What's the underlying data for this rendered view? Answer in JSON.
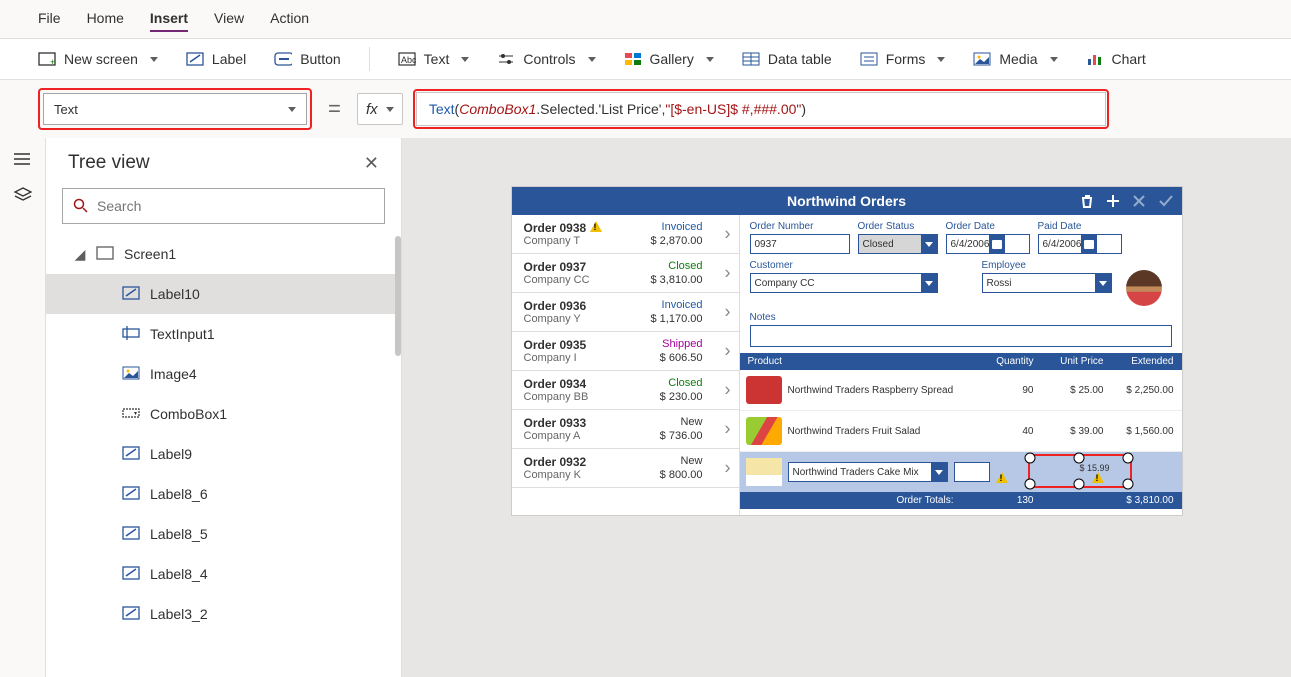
{
  "menu": {
    "file": "File",
    "home": "Home",
    "insert": "Insert",
    "view": "View",
    "action": "Action",
    "active": "insert"
  },
  "ribbon": {
    "newscreen": "New screen",
    "label": "Label",
    "button": "Button",
    "text": "Text",
    "controls": "Controls",
    "gallery": "Gallery",
    "datatable": "Data table",
    "forms": "Forms",
    "media": "Media",
    "chart": "Chart"
  },
  "property": {
    "name": "Text"
  },
  "formula": {
    "fn": "Text",
    "open": "( ",
    "obj": "ComboBox1",
    "mid": ".Selected.'List Price', ",
    "str": "\"[$-en-US]$ #,###.00\"",
    "close": " )"
  },
  "tree": {
    "title": "Tree view",
    "search_placeholder": "Search",
    "items": [
      {
        "name": "Screen1",
        "icon": "screen",
        "depth": 1,
        "expand": true
      },
      {
        "name": "Label10",
        "icon": "label",
        "depth": 2,
        "selected": true
      },
      {
        "name": "TextInput1",
        "icon": "textinput",
        "depth": 2
      },
      {
        "name": "Image4",
        "icon": "image",
        "depth": 2
      },
      {
        "name": "ComboBox1",
        "icon": "combobox",
        "depth": 2
      },
      {
        "name": "Label9",
        "icon": "label",
        "depth": 2
      },
      {
        "name": "Label8_6",
        "icon": "label",
        "depth": 2
      },
      {
        "name": "Label8_5",
        "icon": "label",
        "depth": 2
      },
      {
        "name": "Label8_4",
        "icon": "label",
        "depth": 2
      },
      {
        "name": "Label3_2",
        "icon": "label",
        "depth": 2
      }
    ]
  },
  "app": {
    "title": "Northwind Orders",
    "orders": [
      {
        "id": "Order 0938",
        "company": "Company T",
        "status": "Invoiced",
        "statusClass": "st-invoiced",
        "amount": "$ 2,870.00",
        "warn": true
      },
      {
        "id": "Order 0937",
        "company": "Company CC",
        "status": "Closed",
        "statusClass": "st-closed",
        "amount": "$ 3,810.00"
      },
      {
        "id": "Order 0936",
        "company": "Company Y",
        "status": "Invoiced",
        "statusClass": "st-invoiced",
        "amount": "$ 1,170.00"
      },
      {
        "id": "Order 0935",
        "company": "Company I",
        "status": "Shipped",
        "statusClass": "st-shipped",
        "amount": "$ 606.50"
      },
      {
        "id": "Order 0934",
        "company": "Company BB",
        "status": "Closed",
        "statusClass": "st-closed",
        "amount": "$ 230.00"
      },
      {
        "id": "Order 0933",
        "company": "Company A",
        "status": "New",
        "statusClass": "st-new",
        "amount": "$ 736.00"
      },
      {
        "id": "Order 0932",
        "company": "Company K",
        "status": "New",
        "statusClass": "st-new",
        "amount": "$ 800.00"
      }
    ],
    "detail": {
      "labels": {
        "ordernum": "Order Number",
        "orderstatus": "Order Status",
        "orderdate": "Order Date",
        "paiddate": "Paid Date",
        "customer": "Customer",
        "employee": "Employee",
        "notes": "Notes"
      },
      "ordernum": "0937",
      "orderstatus": "Closed",
      "orderdate": "6/4/2006",
      "paiddate": "6/4/2006",
      "customer": "Company CC",
      "employee": "Rossi"
    },
    "lines": {
      "headers": {
        "product": "Product",
        "qty": "Quantity",
        "unit": "Unit Price",
        "ext": "Extended"
      },
      "items": [
        {
          "name": "Northwind Traders Raspberry Spread",
          "qty": "90",
          "unit": "$ 25.00",
          "ext": "$ 2,250.00",
          "img": ""
        },
        {
          "name": "Northwind Traders Fruit Salad",
          "qty": "40",
          "unit": "$ 39.00",
          "ext": "$ 1,560.00",
          "img": "salad"
        }
      ],
      "newproduct": "Northwind Traders Cake Mix",
      "selvalue": "$ 15.99"
    },
    "totals": {
      "label": "Order Totals:",
      "qty": "130",
      "amount": "$ 3,810.00"
    }
  }
}
